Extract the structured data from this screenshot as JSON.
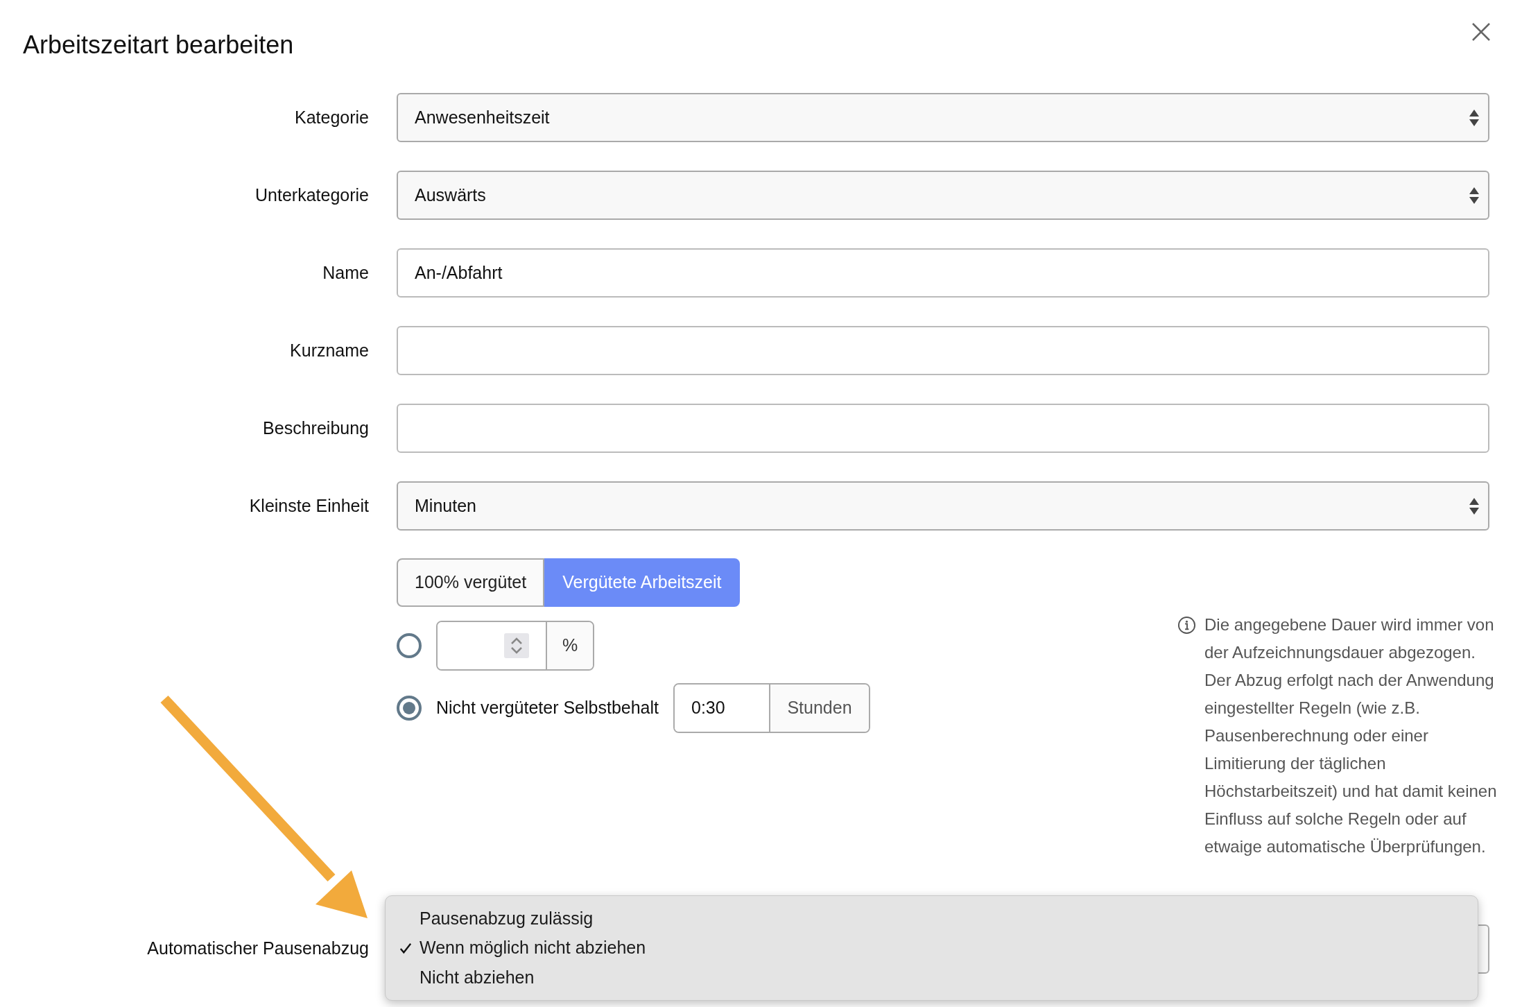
{
  "dialog": {
    "title": "Arbeitszeitart bearbeiten"
  },
  "fields": [
    {
      "label": "Kategorie",
      "kind": "select",
      "value": "Anwesenheitszeit"
    },
    {
      "label": "Unterkategorie",
      "kind": "select",
      "value": "Auswärts"
    },
    {
      "label": "Name",
      "kind": "text",
      "value": "An-/Abfahrt"
    },
    {
      "label": "Kurzname",
      "kind": "text"
    },
    {
      "label": "Beschreibung",
      "kind": "text"
    },
    {
      "label": "Kleinste Einheit",
      "kind": "select",
      "value": "Minuten"
    }
  ],
  "pay_toggle": [
    {
      "label": "100% vergütet",
      "selected": false
    },
    {
      "label": "Vergütete Arbeitszeit",
      "selected": true
    }
  ],
  "options": [
    {
      "kind": "percent",
      "selected": false,
      "unit": "%"
    },
    {
      "kind": "deductible",
      "selected": true,
      "label": "Nicht vergüteter Selbstbehalt",
      "value": "0:30",
      "unit": "Stunden"
    }
  ],
  "help_text": "Die angegebene Dauer wird immer von der Aufzeichnungsdauer abgezogen. Der Abzug erfolgt nach der Anwendung eingestellter Regeln (wie z.B. Pausenberechnung oder einer Limitierung der täglichen Höchstarbeitszeit) und hat damit keinen Einfluss auf solche Regeln oder auf etwaige automatische Überprüfungen.",
  "break_deduction": {
    "label": "Automatischer Pausenabzug",
    "menu": [
      {
        "label": "Pausenabzug zulässig",
        "selected": false
      },
      {
        "label": "Wenn möglich nicht abziehen",
        "selected": true
      },
      {
        "label": "Nicht abziehen",
        "selected": false
      }
    ]
  }
}
